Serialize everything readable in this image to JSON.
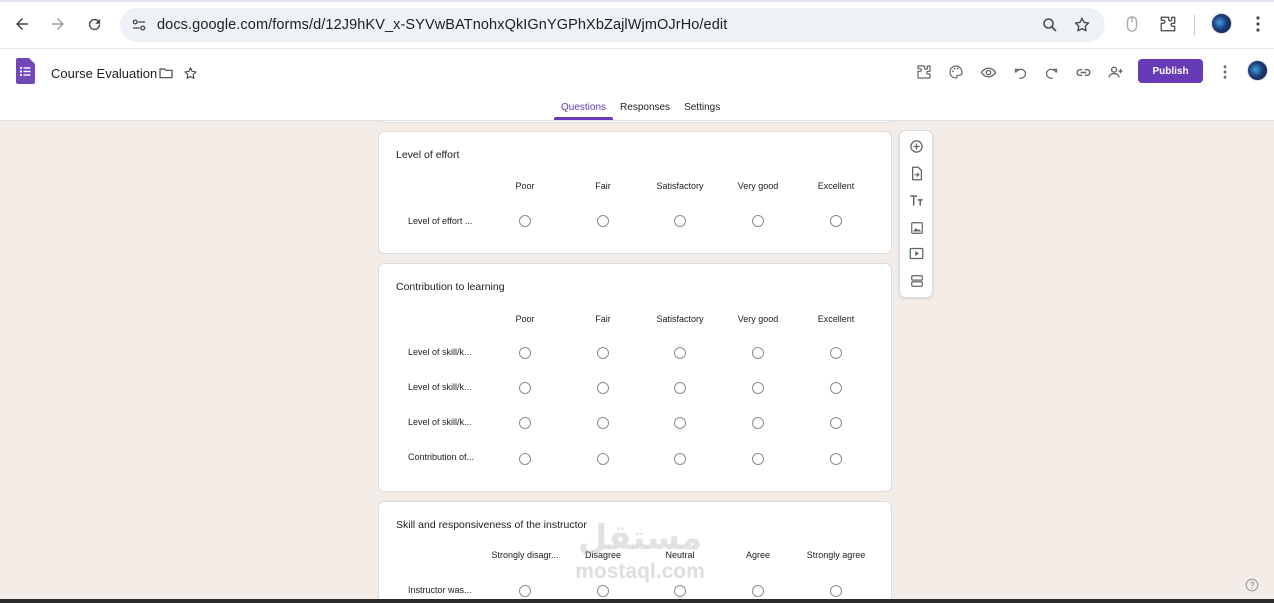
{
  "browser": {
    "url": "docs.google.com/forms/d/12J9hKV_x-SYVwBATnohxQkIGnYGPhXbZajlWjmOJrHo/edit",
    "icons": [
      "back-arrow-icon",
      "forward-arrow-icon",
      "reload-icon",
      "site-settings-icon",
      "zoom-icon",
      "bookmark-star-icon",
      "mouse-icon",
      "extensions-icon",
      "profile-avatar",
      "kebab-menu-icon"
    ]
  },
  "header": {
    "title": "Course Evaluation",
    "publish_label": "Publish",
    "accent": "#673ab7",
    "icons": [
      "add-ons-icon",
      "palette-icon",
      "preview-eye-icon",
      "undo-icon",
      "redo-icon",
      "link-icon",
      "add-collaborator-icon",
      "more-vert-icon"
    ]
  },
  "tabs": [
    {
      "label": "Questions",
      "active": true
    },
    {
      "label": "Responses",
      "active": false
    },
    {
      "label": "Settings",
      "active": false
    }
  ],
  "questions": [
    {
      "title": "Level of effort",
      "columns": [
        "Poor",
        "Fair",
        "Satisfactory",
        "Very good",
        "Excellent"
      ],
      "rows": [
        "Level of effort ..."
      ]
    },
    {
      "title": "Contribution to learning",
      "columns": [
        "Poor",
        "Fair",
        "Satisfactory",
        "Very good",
        "Excellent"
      ],
      "rows": [
        "Level of skill/k...",
        "Level of skill/k...",
        "Level of skill/k...",
        "Contribution of..."
      ]
    },
    {
      "title": "Skill and responsiveness of the instructor",
      "columns": [
        "Strongly disagr...",
        "Disagree",
        "Neutral",
        "Agree",
        "Strongly agree"
      ],
      "rows": [
        "Instructor was..."
      ]
    }
  ],
  "toolbar": [
    "add-question-icon",
    "import-questions-icon",
    "add-title-icon",
    "add-image-icon",
    "add-video-icon",
    "add-section-icon"
  ],
  "watermark": {
    "arabic": "مستقل",
    "latin": "mostaql.com"
  }
}
